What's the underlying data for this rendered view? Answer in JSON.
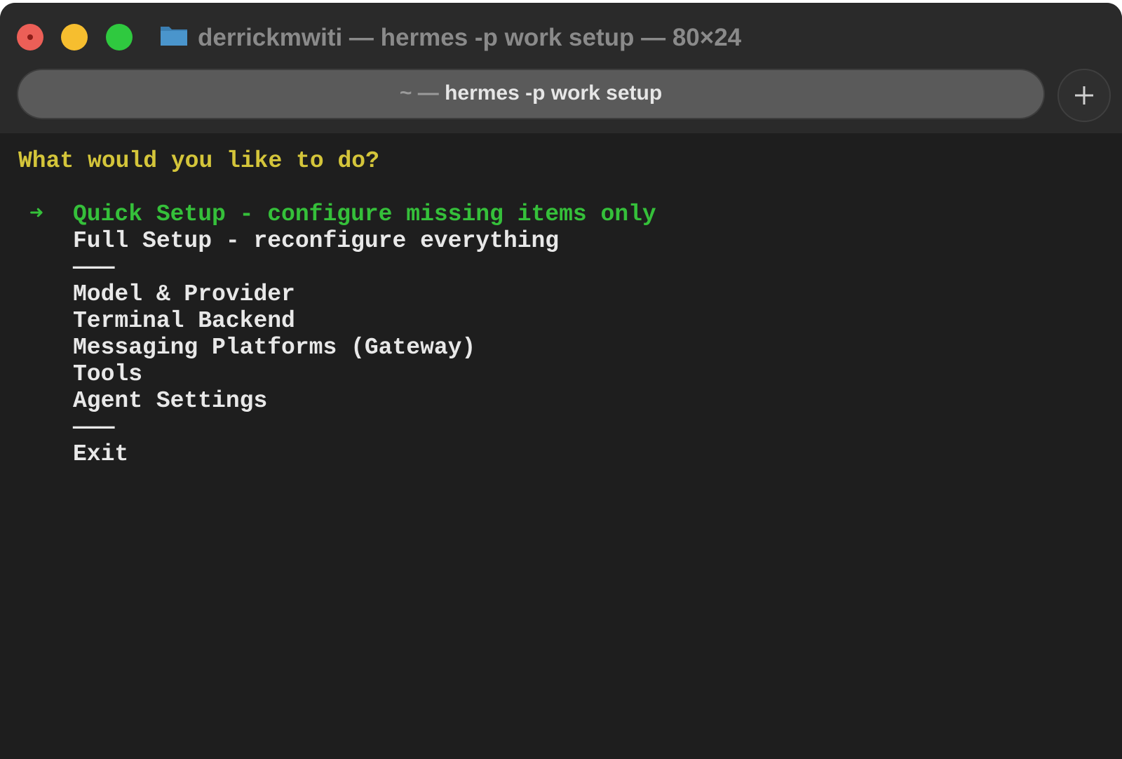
{
  "window": {
    "title": "derrickmwiti — hermes -p work setup — 80×24",
    "folder_icon": "folder-icon",
    "traffic_lights": [
      "close",
      "minimize",
      "zoom"
    ]
  },
  "tab": {
    "prefix": "~ —",
    "label": "hermes -p work setup",
    "new_tab_icon": "plus-icon"
  },
  "terminal": {
    "prompt": "What would you like to do?",
    "cursor_marker": "➜",
    "menu": [
      "Quick Setup - configure missing items only",
      "Full Setup - reconfigure everything",
      "———",
      "Model & Provider",
      "Terminal Backend",
      "Messaging Platforms (Gateway)",
      "Tools",
      "Agent Settings",
      "———",
      "Exit"
    ],
    "selected_index": 0
  },
  "colors": {
    "background": "#1e1e1e",
    "prompt": "#d4c53a",
    "selected": "#35c03a",
    "text": "#e8e8e8"
  }
}
